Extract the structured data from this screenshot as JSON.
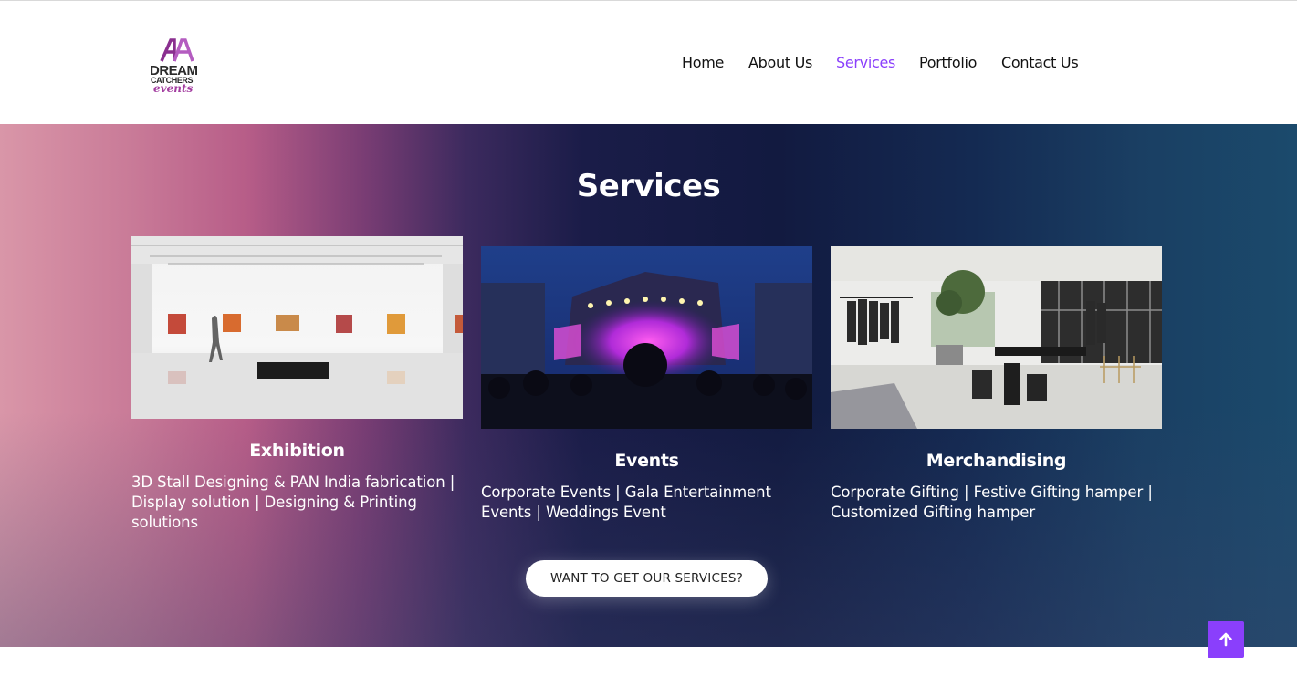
{
  "brand": {
    "logo_line1": "DREAM",
    "logo_line2": "CATCHERS",
    "logo_line3": "events"
  },
  "nav": {
    "items": [
      {
        "label": "Home"
      },
      {
        "label": "About Us"
      },
      {
        "label": "Services",
        "active": true
      },
      {
        "label": "Portfolio"
      },
      {
        "label": "Contact Us"
      }
    ]
  },
  "services": {
    "title": "Services",
    "cards": [
      {
        "title": "Exhibition",
        "description": "3D Stall Designing & PAN India fabrication | Display solution | Designing & Printing solutions",
        "image": "art-gallery-photo"
      },
      {
        "title": "Events",
        "description": "Corporate Events | Gala Entertainment Events | Weddings Event",
        "image": "concert-stage-photo"
      },
      {
        "title": "Merchandising",
        "description": "Corporate Gifting | Festive Gifting hamper | Customized Gifting hamper",
        "image": "showroom-interior-photo"
      }
    ],
    "cta_label": "WANT TO GET OUR SERVICES?"
  },
  "scroll_top": {
    "icon": "arrow-up-icon"
  },
  "colors": {
    "accent": "#8a3ffc",
    "nav_text": "#111111"
  }
}
